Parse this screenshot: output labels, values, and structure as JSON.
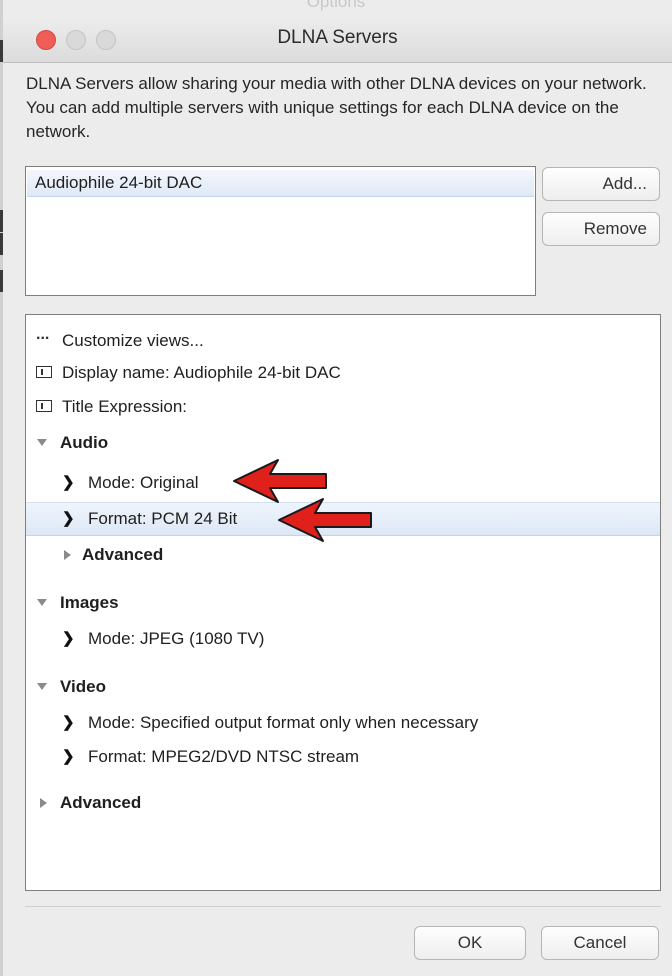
{
  "window": {
    "background_title": "Options",
    "title": "DLNA Servers"
  },
  "description": "DLNA Servers allow sharing your media with other DLNA devices on your network.  You can add multiple servers with unique settings for each DLNA device on the network.",
  "servers": {
    "items": [
      "Audiophile 24-bit DAC"
    ],
    "add_label": "Add...",
    "remove_label": "Remove"
  },
  "options": {
    "customize": "Customize views...",
    "display_name": "Display name: Audiophile 24-bit DAC",
    "title_expression": "Title Expression:",
    "audio": {
      "label": "Audio",
      "mode": "Mode: Original",
      "format": "Format: PCM 24 Bit",
      "advanced": "Advanced"
    },
    "images": {
      "label": "Images",
      "mode": "Mode: JPEG (1080 TV)"
    },
    "video": {
      "label": "Video",
      "mode": "Mode: Specified output format only when necessary",
      "format": "Format: MPEG2/DVD NTSC stream"
    },
    "advanced": "Advanced"
  },
  "footer": {
    "ok_label": "OK",
    "cancel_label": "Cancel"
  },
  "colors": {
    "annotation_arrow": "#e0201a",
    "selection": "#dde8f5",
    "close_button": "#ee5e57"
  },
  "icons": {
    "ellipsis": "ellipsis-icon",
    "field": "text-field-icon",
    "expanded": "disclosure-down-icon",
    "collapsed": "disclosure-right-icon",
    "dropdown": "chevron-down-icon",
    "annotation": "red-arrow-icon"
  }
}
